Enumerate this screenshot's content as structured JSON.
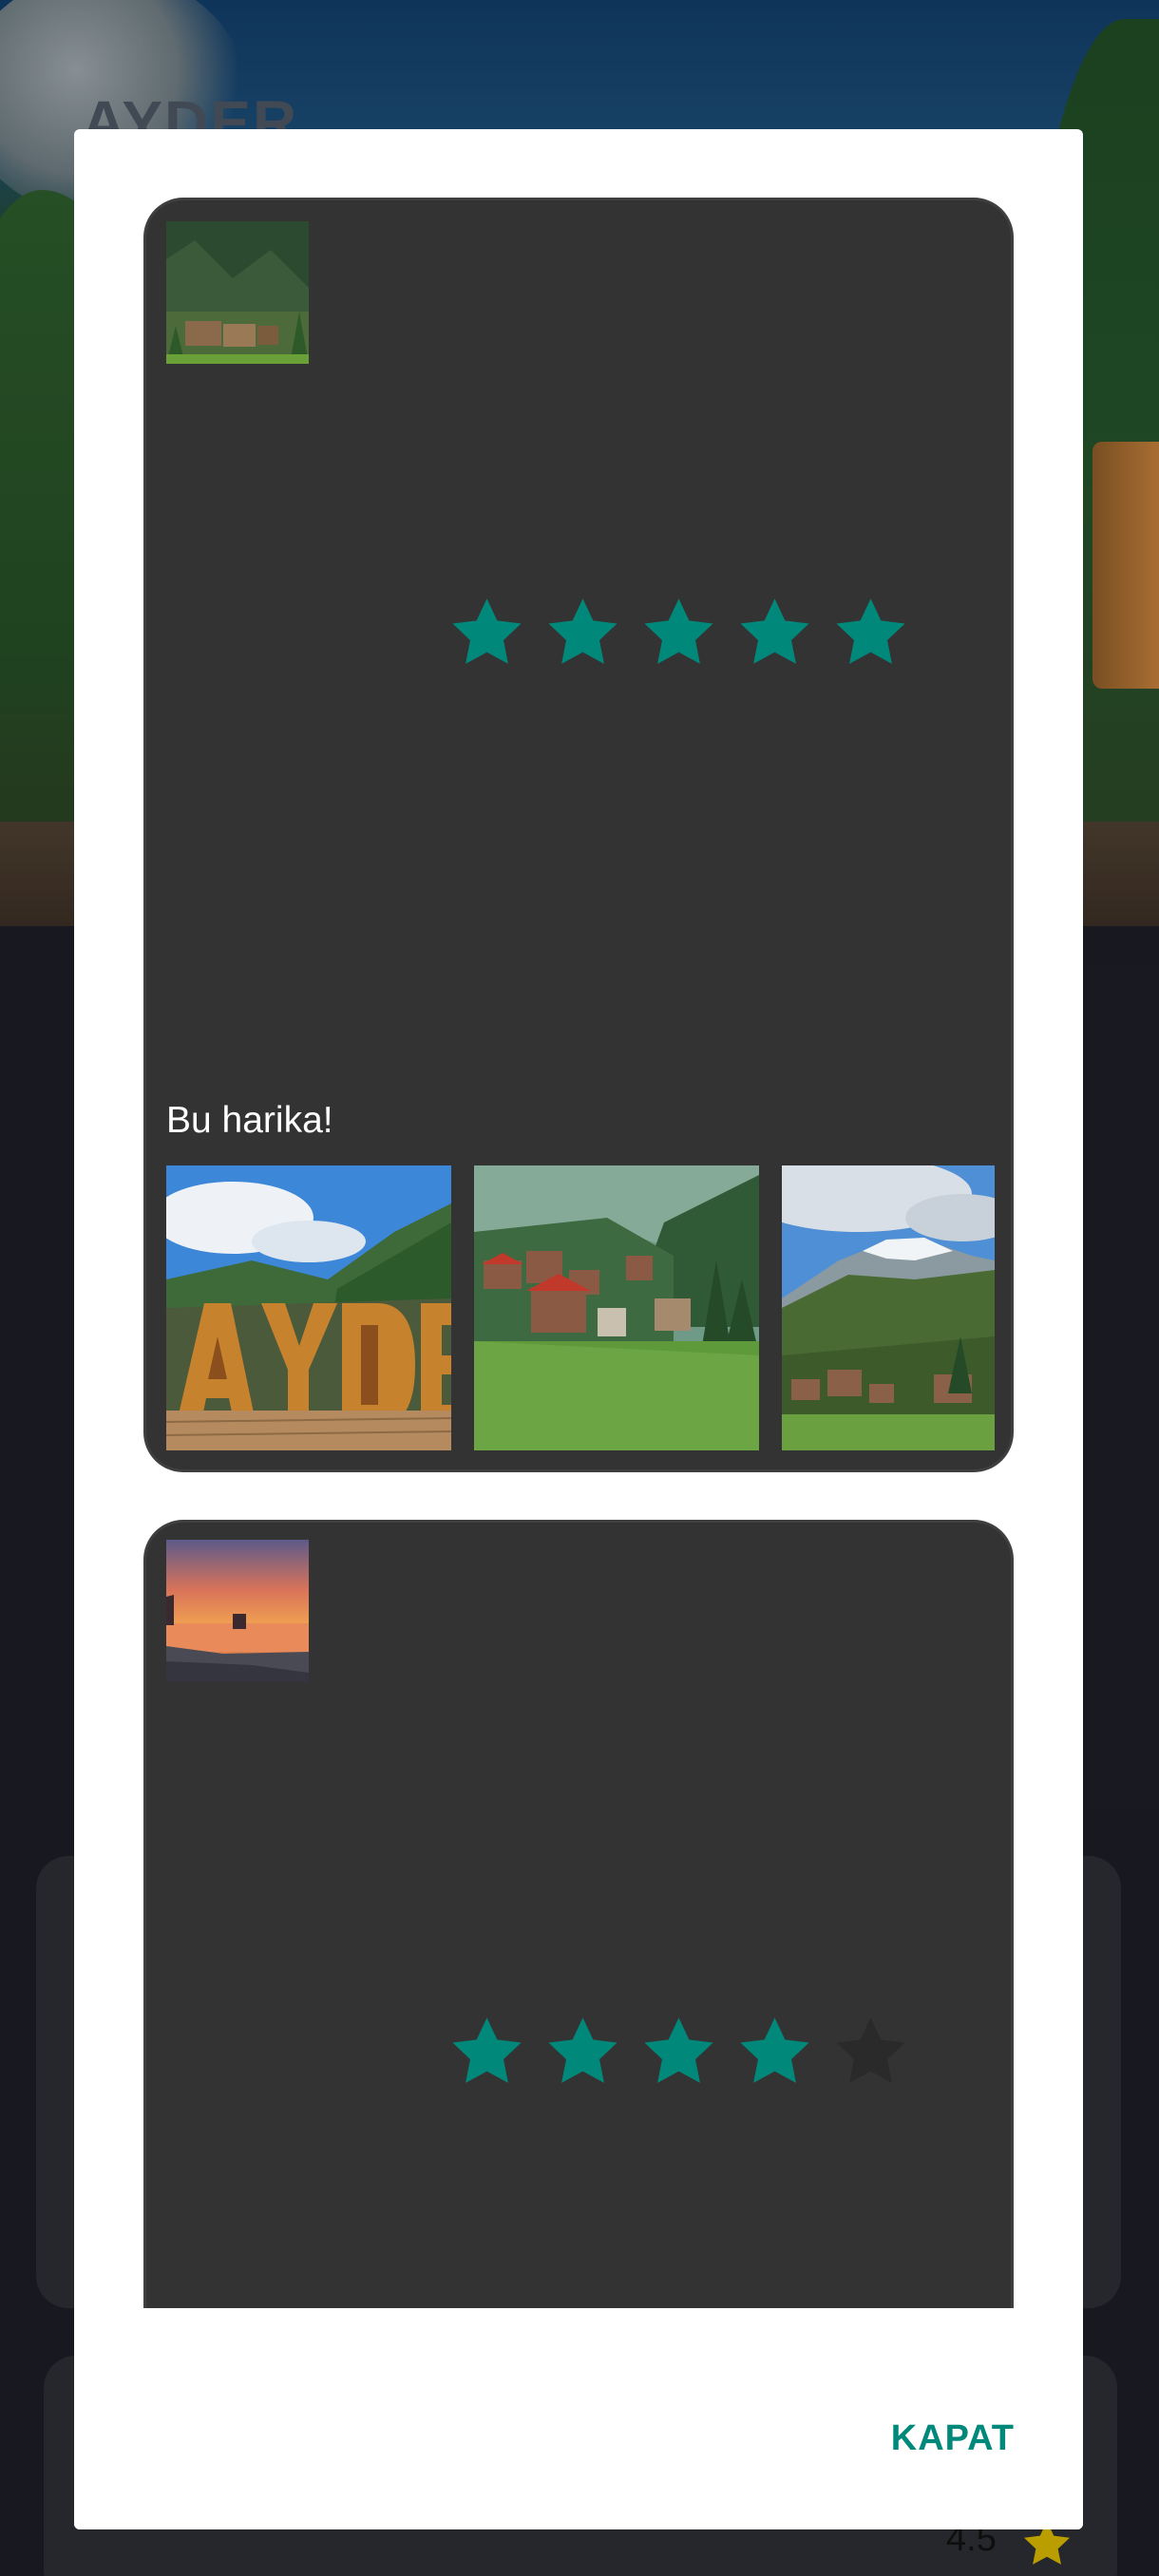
{
  "background": {
    "hero_title": "AYDER",
    "rating_value": "4.5"
  },
  "dialog": {
    "close_label": "KAPAT",
    "accent_color": "#00897b",
    "reviews": [
      {
        "rating": 5,
        "max_rating": 5,
        "comment": "Bu harika!",
        "photo_count": 3
      },
      {
        "rating": 4,
        "max_rating": 5,
        "comment": ""
      }
    ]
  }
}
